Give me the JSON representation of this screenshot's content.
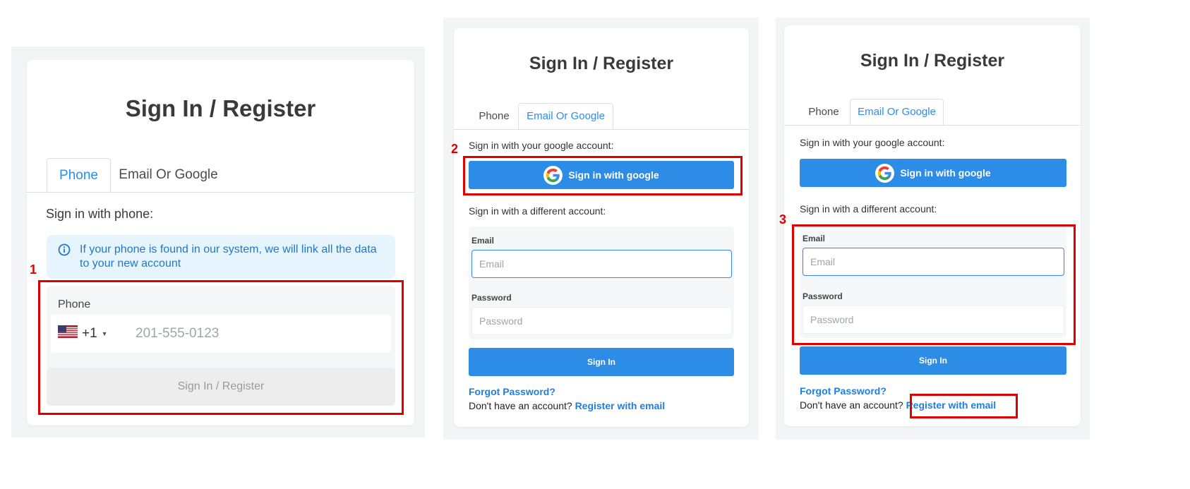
{
  "title": "Sign In / Register",
  "tabs": {
    "phone": "Phone",
    "email": "Email Or Google"
  },
  "screen1": {
    "subtitle": "Sign in with phone:",
    "info_text": "If your phone is found in our system, we will link all the data to your new account",
    "phone_label": "Phone",
    "country_code": "+1",
    "phone_placeholder": "201-555-0123",
    "submit_label": "Sign In / Register",
    "step": "1"
  },
  "google_section": {
    "label": "Sign in with your google account:",
    "button_label": "Sign in with google"
  },
  "different_account_label": "Sign in with a different account:",
  "email_label": "Email",
  "email_placeholder": "Email",
  "password_label": "Password",
  "password_placeholder": "Password",
  "sign_in_label": "Sign In",
  "forgot_password": "Forgot Password?",
  "no_account_text": "Don't have an account?",
  "register_link": "Register with email",
  "steps": {
    "two": "2",
    "three": "3"
  },
  "colors": {
    "accent": "#2d8ce6",
    "highlight": "#e00000",
    "tab_active": "#2d8cf0"
  },
  "icons": {
    "google": "google-g-icon",
    "info": "info-circle-icon",
    "flag": "us-flag-icon",
    "caret": "caret-down-icon"
  }
}
